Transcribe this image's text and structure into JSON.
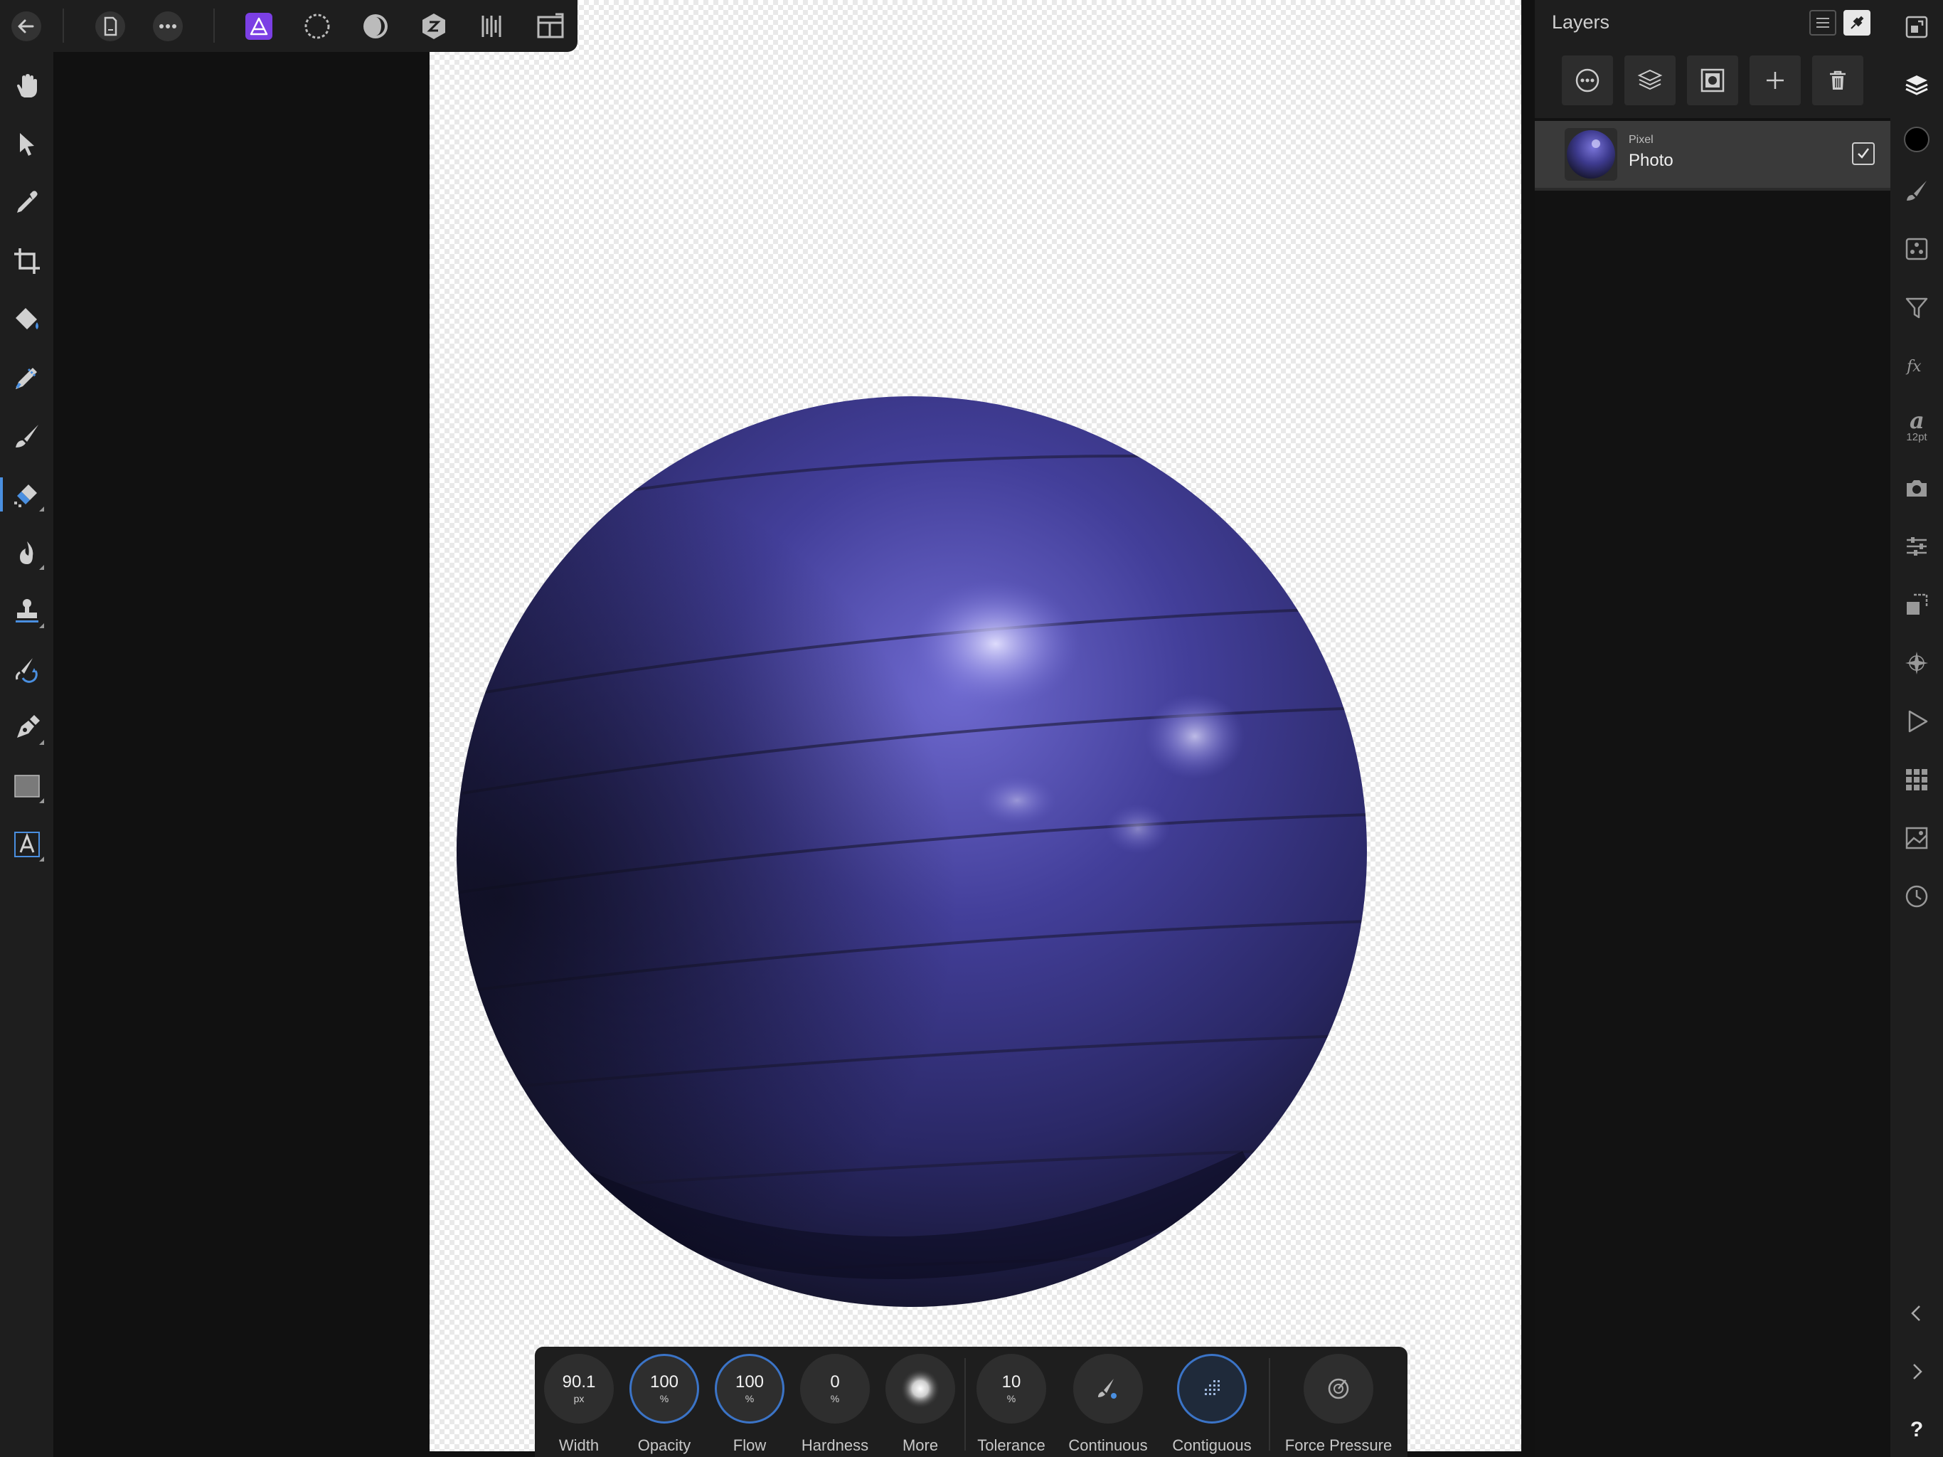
{
  "colors": {
    "accent": "#3b74c7",
    "persona": "#7b3fe4",
    "panel": "#1e1e1e",
    "workspace": "#111111",
    "ball": "#3d3a8e"
  },
  "top_toolbar": {
    "icons": [
      "back-icon",
      "document-icon",
      "more-icon",
      "photo-persona-icon",
      "liquify-persona-icon",
      "develop-persona-icon",
      "tone-mapping-persona-icon",
      "export-persona-icon",
      "view-mode-icon"
    ]
  },
  "left_tools": [
    "view-tool",
    "move-tool",
    "color-picker-tool",
    "crop-tool",
    "flood-fill-tool",
    "selection-brush-tool",
    "paint-brush-tool",
    "erase-brush-tool",
    "burn-tool",
    "clone-tool",
    "undo-brush-tool",
    "pen-tool",
    "rectangle-tool",
    "artistic-text-tool"
  ],
  "layers_panel": {
    "title": "Layers",
    "layer": {
      "type": "Pixel",
      "name": "Photo"
    }
  },
  "right_strip": {
    "character_size": "12pt"
  },
  "context_toolbar": {
    "width": {
      "value": "90.1",
      "unit": "px",
      "label": "Width"
    },
    "opacity": {
      "value": "100",
      "unit": "%",
      "label": "Opacity"
    },
    "flow": {
      "value": "100",
      "unit": "%",
      "label": "Flow"
    },
    "hardness": {
      "value": "0",
      "unit": "%",
      "label": "Hardness"
    },
    "more": {
      "label": "More"
    },
    "tolerance": {
      "value": "10",
      "unit": "%",
      "label": "Tolerance"
    },
    "continuous": {
      "label": "Continuous"
    },
    "contiguous": {
      "label": "Contiguous"
    },
    "force_pressure": {
      "label": "Force Pressure"
    }
  },
  "help": "?"
}
